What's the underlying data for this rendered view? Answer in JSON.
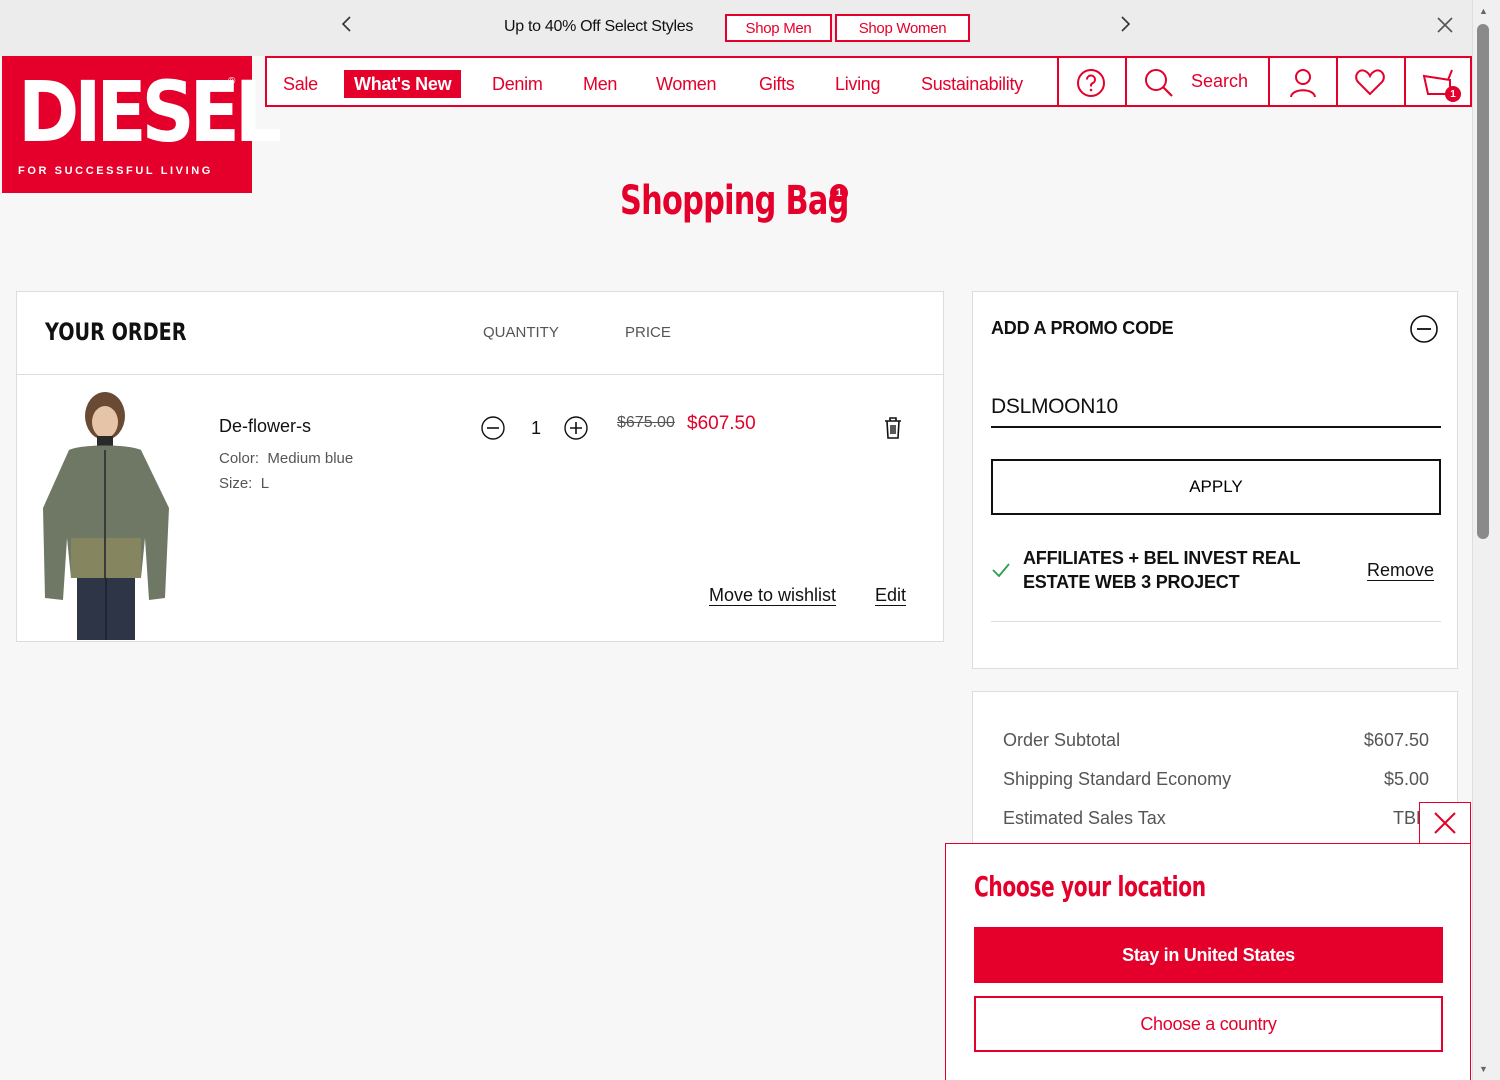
{
  "promo_bar": {
    "text": "Up to 40% Off Select Styles",
    "shop_men": "Shop Men",
    "shop_women": "Shop Women",
    "prev_icon": "chevron-left-icon",
    "next_icon": "chevron-right-icon",
    "close_icon": "close-icon"
  },
  "logo": {
    "word": "DIESEL",
    "reg": "®",
    "tagline": "FOR SUCCESSFUL LIVING"
  },
  "nav": {
    "items": [
      "Sale",
      "What's New",
      "Denim",
      "Men",
      "Women",
      "Gifts",
      "Living",
      "Sustainability"
    ],
    "active": "What's New",
    "search_label": "Search",
    "cart_count": "1"
  },
  "page": {
    "title": "Shopping Bag",
    "count": "1"
  },
  "order": {
    "title": "YOUR ORDER",
    "col_quantity": "QUANTITY",
    "col_price": "PRICE",
    "item": {
      "name": "De-flower-s",
      "color_label": "Color:",
      "color_value": "Medium blue",
      "size_label": "Size:",
      "size_value": "L",
      "quantity": "1",
      "price_original": "$675.00",
      "price_sale": "$607.50",
      "move_to_wishlist": "Move to wishlist",
      "edit": "Edit"
    }
  },
  "promo": {
    "title": "ADD A PROMO CODE",
    "code_value": "DSLMOON10",
    "apply_label": "APPLY",
    "applied_name": "AFFILIATES + BEL INVEST REAL ESTATE WEB 3 PROJECT",
    "remove_label": "Remove"
  },
  "summary": {
    "rows": [
      {
        "label": "Order Subtotal",
        "value": "$607.50"
      },
      {
        "label": "Shipping Standard Economy",
        "value": "$5.00"
      },
      {
        "label": "Estimated Sales Tax",
        "value": "TBD"
      }
    ]
  },
  "location": {
    "title": "Choose your location",
    "stay_label": "Stay in United States",
    "choose_label": "Choose a country"
  },
  "colors": {
    "brand_red": "#e4002b",
    "text": "#111111",
    "muted": "#555555",
    "success_green": "#2e9e4f"
  }
}
